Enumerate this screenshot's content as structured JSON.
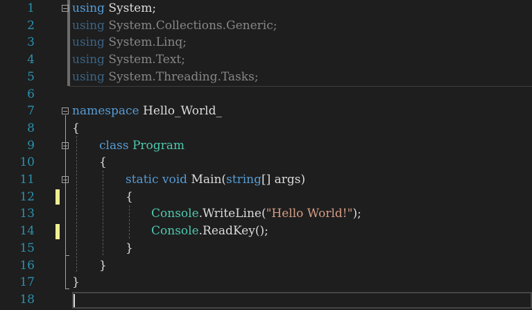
{
  "line_numbers": [
    "1",
    "2",
    "3",
    "4",
    "5",
    "6",
    "7",
    "8",
    "9",
    "10",
    "11",
    "12",
    "13",
    "14",
    "15",
    "16",
    "17",
    "18"
  ],
  "code": {
    "l1": {
      "kw": "using",
      "rest": " System;"
    },
    "l2": {
      "kw": "using",
      "rest": " System.Collections.Generic;"
    },
    "l3": {
      "kw": "using",
      "rest": " System.Linq;"
    },
    "l4": {
      "kw": "using",
      "rest": " System.Text;"
    },
    "l5": {
      "kw": "using",
      "rest": " System.Threading.Tasks;"
    },
    "l7": {
      "kw": "namespace",
      "rest": " Hello_World_"
    },
    "l8": {
      "text": "{"
    },
    "l9": {
      "kw": "class",
      "type": "Program"
    },
    "l10": {
      "text": "{"
    },
    "l11": {
      "kw1": "static",
      "kw2": "void",
      "name": "Main(",
      "kw3": "string",
      "rest": "[] args)"
    },
    "l12": {
      "text": "{"
    },
    "l13": {
      "type": "Console",
      "call": ".WriteLine(",
      "str": "\"Hello World!\"",
      "end": ");"
    },
    "l14": {
      "type": "Console",
      "call": ".ReadKey();"
    },
    "l15": {
      "text": "}"
    },
    "l16": {
      "text": "}"
    },
    "l17": {
      "text": "}"
    }
  },
  "colors": {
    "background": "#1e1e1e",
    "line_number": "#2b91af",
    "keyword": "#569cd6",
    "type": "#4ec9b0",
    "string": "#d69d85",
    "text": "#dcdcdc",
    "change_marker": "#efef91"
  }
}
